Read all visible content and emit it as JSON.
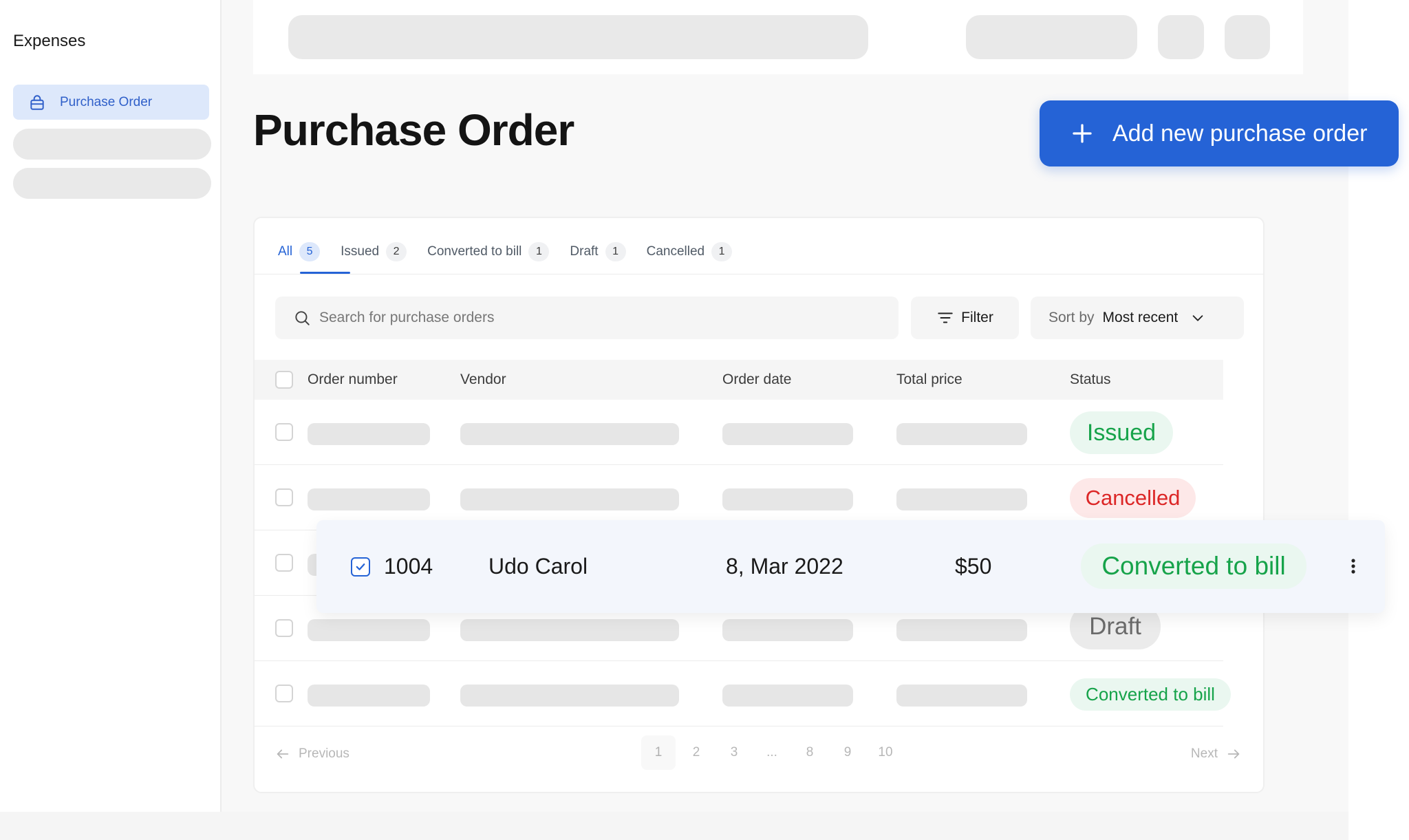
{
  "sidebar": {
    "title": "Expenses",
    "active_item": {
      "label": "Purchase Order",
      "icon": "shopping-bag-icon"
    }
  },
  "page": {
    "title": "Purchase Order",
    "add_button_label": "Add new purchase order"
  },
  "tabs": [
    {
      "label": "All",
      "count": "5",
      "active": true
    },
    {
      "label": "Issued",
      "count": "2"
    },
    {
      "label": "Converted to bill",
      "count": "1"
    },
    {
      "label": "Draft",
      "count": "1"
    },
    {
      "label": "Cancelled",
      "count": "1"
    }
  ],
  "toolbar": {
    "search_placeholder": "Search for purchase orders",
    "filter_label": "Filter",
    "sort_prefix": "Sort by",
    "sort_value": "Most recent"
  },
  "table": {
    "columns": [
      "Order number",
      "Vendor",
      "Order date",
      "Total price",
      "Status"
    ],
    "row_statuses": [
      "Issued",
      "Cancelled",
      "Converted to bill",
      "Draft",
      "Converted to bill"
    ]
  },
  "highlighted_row": {
    "order_number": "1004",
    "vendor": "Udo Carol",
    "order_date": "8, Mar 2022",
    "total_price": "$50",
    "status": "Converted to bill",
    "selected": true
  },
  "pagination": {
    "previous_label": "Previous",
    "next_label": "Next",
    "pages": [
      "1",
      "2",
      "3",
      "...",
      "8",
      "9",
      "10"
    ],
    "current_page": "1"
  },
  "colors": {
    "accent": "#2563d6",
    "status_green": "#16a34a",
    "status_red": "#dc2626",
    "status_gray": "#6b6b6b"
  }
}
